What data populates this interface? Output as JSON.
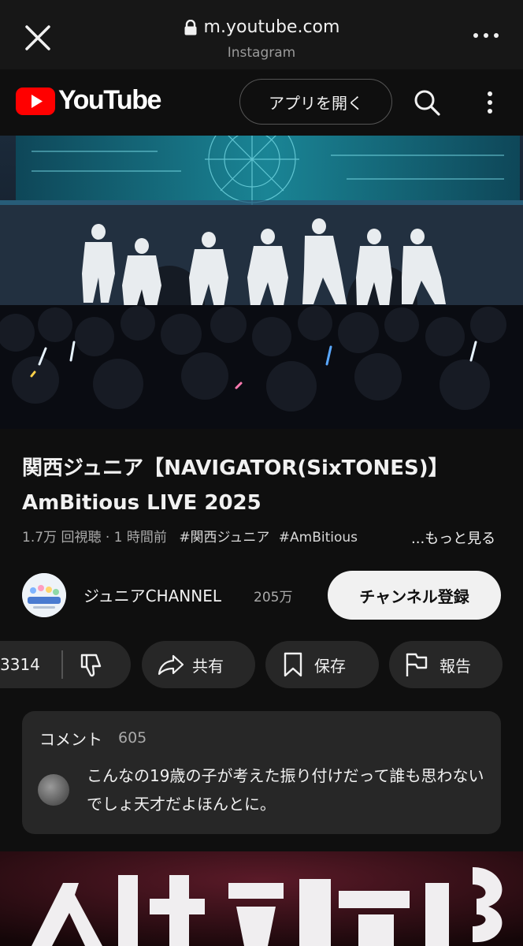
{
  "browser": {
    "url": "m.youtube.com",
    "source": "Instagram"
  },
  "header": {
    "logo_text": "YouTube",
    "open_app_label": "アプリを開く"
  },
  "video": {
    "title": "関西ジュニア【NAVIGATOR(SixTONES)】AmBitious LIVE 2025",
    "views": "1.7万 回視聴",
    "time_ago": "1 時間前",
    "hashtags": [
      "#関西ジュニア",
      "#AmBitious"
    ],
    "more_label": "...もっと見る"
  },
  "channel": {
    "name": "ジュニアCHANNEL",
    "subscribers": "205万",
    "subscribe_label": "チャンネル登録"
  },
  "actions": {
    "like_count": "3314",
    "share_label": "共有",
    "save_label": "保存",
    "report_label": "報告"
  },
  "comments": {
    "title": "コメント",
    "count": "605",
    "top_comment": "こんなの19歳の子が考えた振り付けだって誰も思わないでしょ天才だよほんとに。"
  },
  "colors": {
    "background": "#0f0f0f",
    "youtube_red": "#ff0000",
    "pill_bg": "#272727",
    "subscribe_bg": "#f1f1f1"
  },
  "icons": [
    "close-icon",
    "lock-icon",
    "more-horizontal-icon",
    "youtube-logo-icon",
    "search-icon",
    "more-vertical-icon",
    "dislike-icon",
    "share-icon",
    "bookmark-icon",
    "flag-icon"
  ]
}
